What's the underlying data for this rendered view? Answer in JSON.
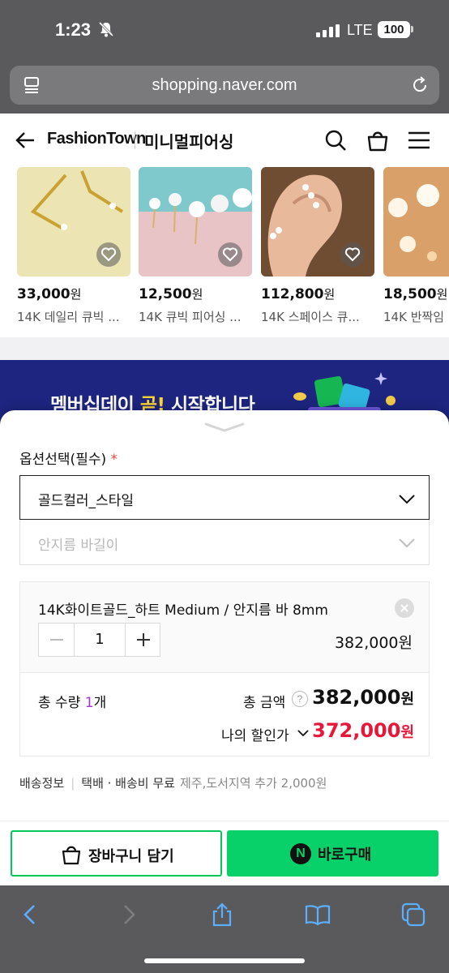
{
  "status_bar": {
    "time": "1:23",
    "network": "LTE",
    "battery": "100"
  },
  "browser": {
    "url": "shopping.naver.com"
  },
  "header": {
    "brand": "FashionTown",
    "category": "미니멀피어싱"
  },
  "products": [
    {
      "price": "33,000",
      "currency": "원",
      "name": "14K 데일리 큐빅 ..."
    },
    {
      "price": "12,500",
      "currency": "원",
      "name": "14K 큐빅 피어싱 ..."
    },
    {
      "price": "112,800",
      "currency": "원",
      "name": "14K 스페이스 큐..."
    },
    {
      "price": "18,500",
      "currency": "원",
      "name": "14K 반짝임"
    }
  ],
  "banner": {
    "text_before": "멤버십데이 ",
    "text_emphasis": "곧!",
    "text_after": " 시작합니다"
  },
  "option_sheet": {
    "label": "옵션선택(필수)",
    "required_mark": "*",
    "select1_value": "골드컬러_스타일",
    "select2_placeholder": "안지름 바길이",
    "selected_option": {
      "name": "14K화이트골드_하트 Medium / 안지름 바 8mm",
      "quantity": "1",
      "price": "382,000원"
    },
    "total": {
      "qty_label_prefix": "총 수량 ",
      "qty_value": "1",
      "qty_label_suffix": "개",
      "amount_label": "총 금액",
      "amount_help": "?",
      "amount": "382,000",
      "amount_currency": "원",
      "discount_label": "나의 할인가",
      "discount_amount": "372,000",
      "discount_currency": "원"
    },
    "shipping": {
      "label": "배송정보",
      "method": "택배 · 배송비 무료",
      "extra": "제주,도서지역 추가 2,000원"
    }
  },
  "buttons": {
    "cart": "장바구니 담기",
    "buy": "바로구매",
    "buy_logo": "N"
  },
  "colors": {
    "naver_green": "#03c75a",
    "discount_red": "#e8173a",
    "banner_bg": "#1d2580",
    "accent_purple": "#a633d9"
  }
}
